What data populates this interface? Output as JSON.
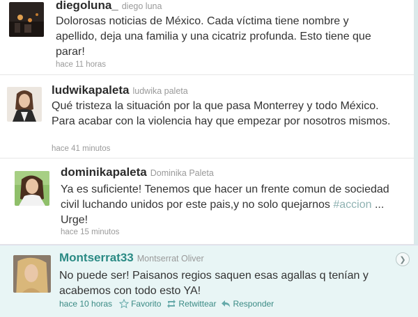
{
  "tweets": [
    {
      "screen_name": "diegoluna_",
      "full_name": "diego luna",
      "text": "Dolorosas noticias de México. Cada víctima tiene nombre y apellido, deja una familia y una cicatriz profunda. Esto tiene que parar!",
      "time": "hace 11 horas"
    },
    {
      "screen_name": "ludwikapaleta",
      "full_name": "ludwika paleta",
      "text": "Qué tristeza la situación por la que pasa Monterrey y todo México. Para acabar con la violencia hay que empezar por nosotros mismos.",
      "time": "hace 41 minutos"
    },
    {
      "screen_name": "dominikapaleta",
      "full_name": "Dominika Paleta",
      "text_before": "Ya es suficiente! Tenemos que hacer un frente comun de sociedad civil luchando unidos por este pais,y no solo quejarnos ",
      "hashtag": "#accion",
      "text_after": " ... Urge!",
      "time": "hace 15 minutos"
    },
    {
      "screen_name": "Montserrat33",
      "full_name": "Montserrat Oliver",
      "text": "No puede ser! Paisanos regios saquen esas agallas q tenían y acabemos con todo esto YA!",
      "time": "hace 10 horas",
      "actions": {
        "favorite": "Favorito",
        "retweet": "Retwittear",
        "reply": "Responder"
      }
    }
  ],
  "colors": {
    "link": "#2a8a84",
    "highlight_bg": "#e8f5f5"
  }
}
